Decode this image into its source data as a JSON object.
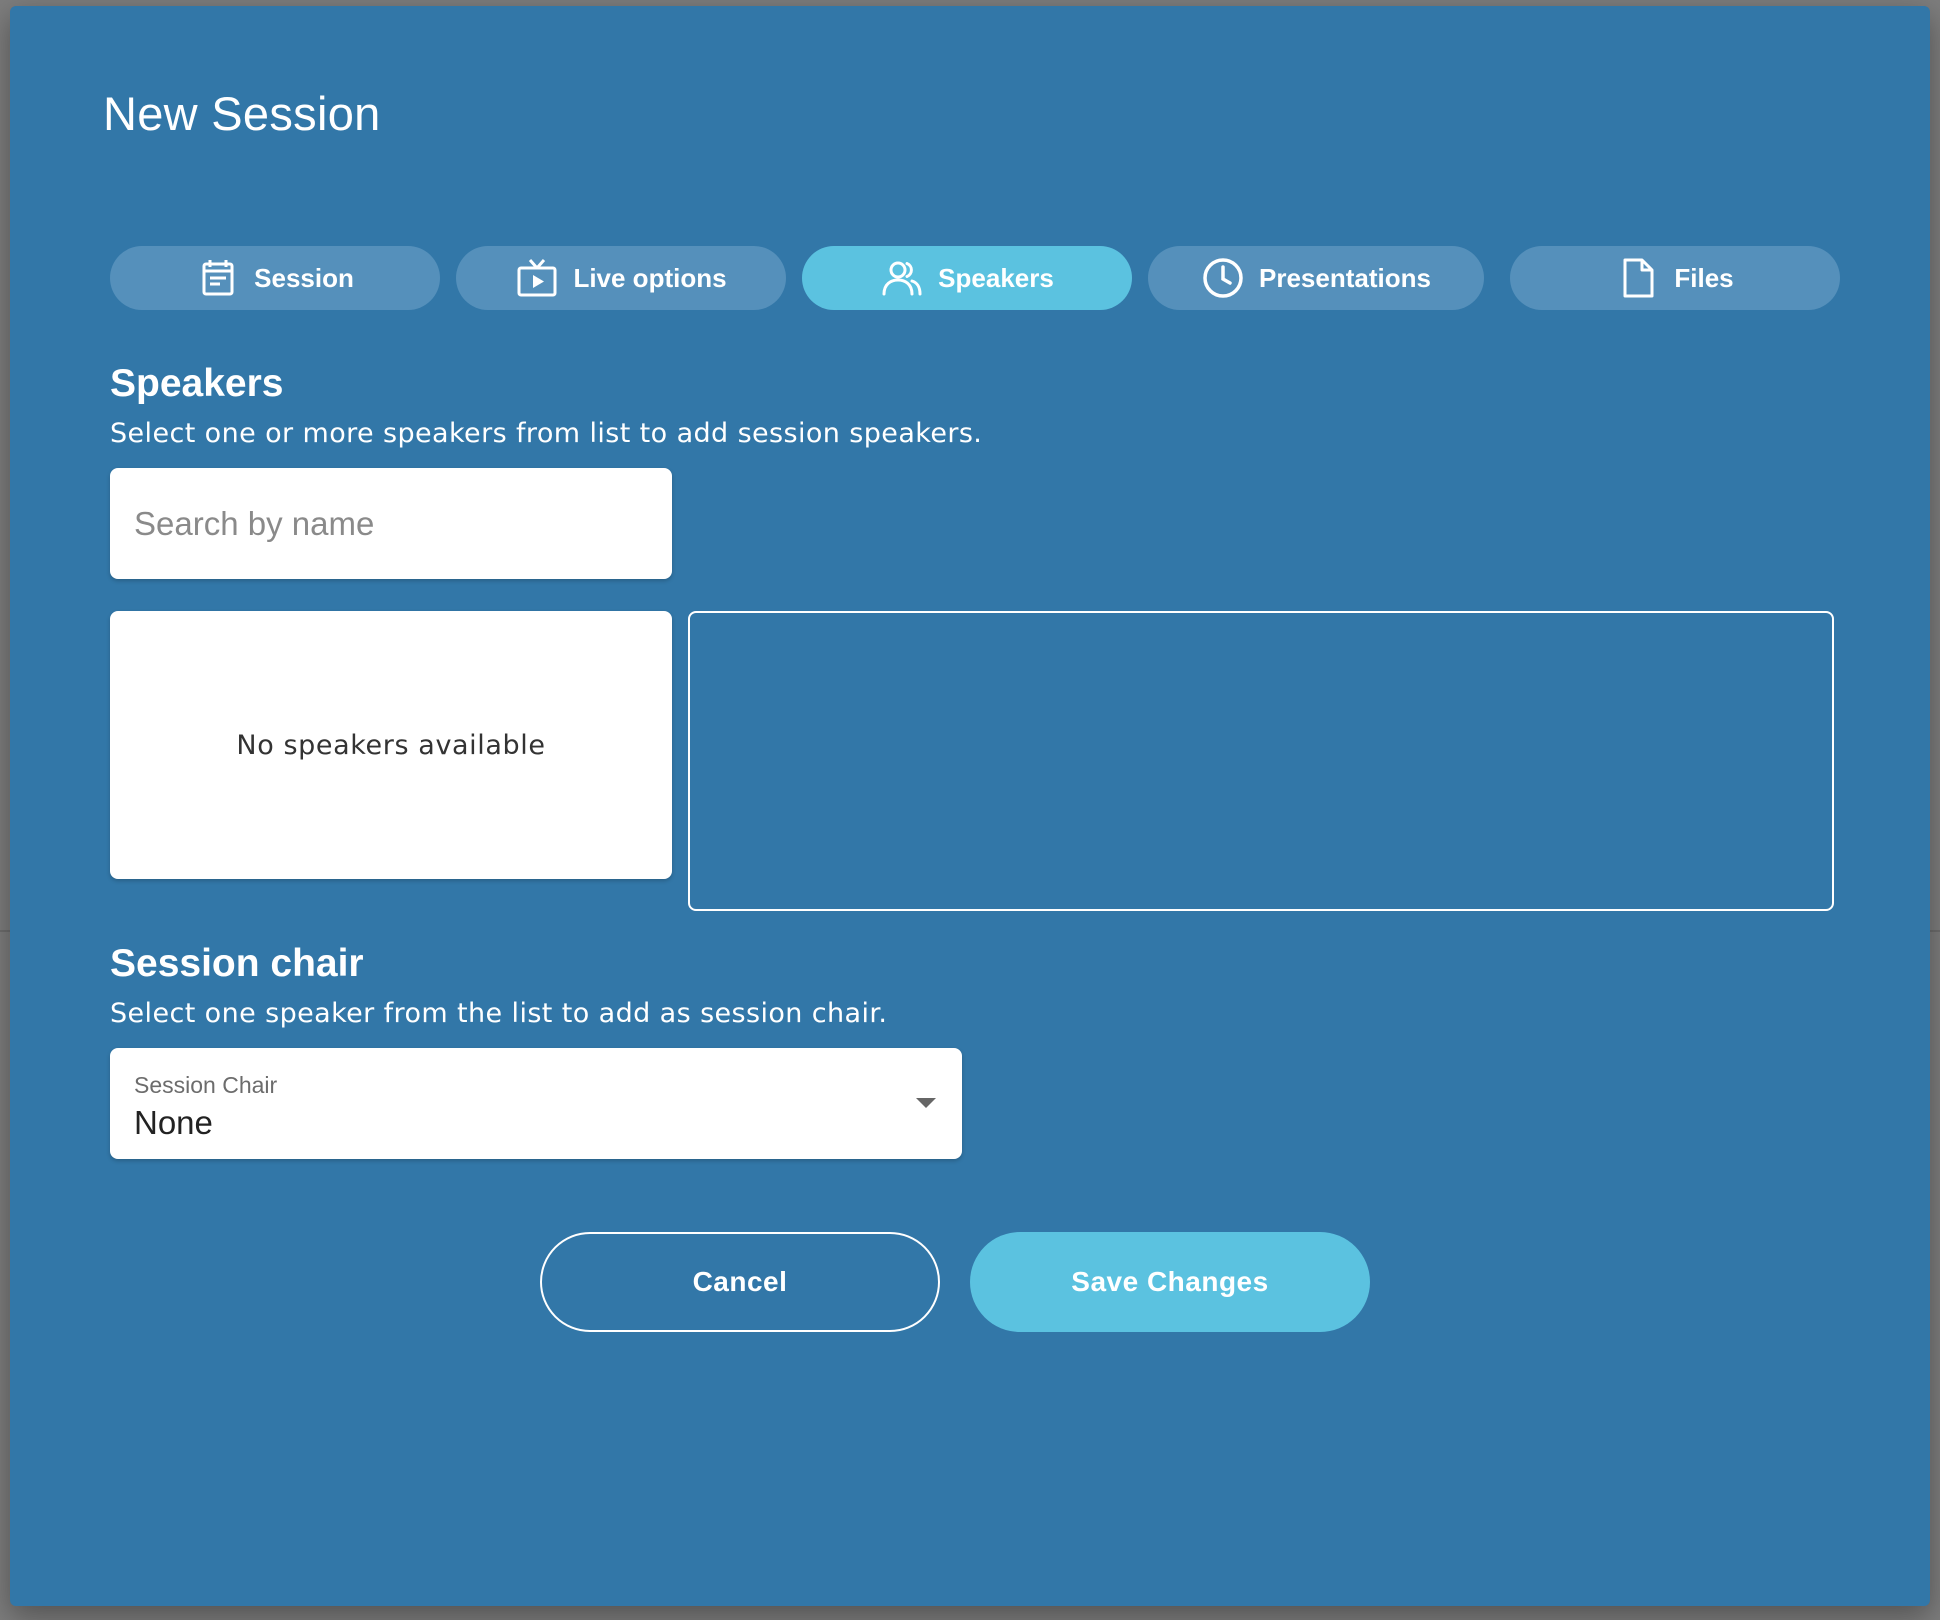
{
  "dialog": {
    "title": "New Session"
  },
  "tabs": [
    {
      "label": "Session",
      "icon": "calendar-icon",
      "active": false
    },
    {
      "label": "Live options",
      "icon": "live-tv-icon",
      "active": false
    },
    {
      "label": "Speakers",
      "icon": "people-icon",
      "active": true
    },
    {
      "label": "Presentations",
      "icon": "clock-icon",
      "active": false
    },
    {
      "label": "Files",
      "icon": "file-icon",
      "active": false
    }
  ],
  "speakers": {
    "heading": "Speakers",
    "description": "Select one or more speakers from list to add session speakers.",
    "search_placeholder": "Search by name",
    "empty_text": "No speakers available"
  },
  "session_chair": {
    "heading": "Session chair",
    "description": "Select one speaker from the list to add as session chair.",
    "field_label": "Session Chair",
    "value": "None"
  },
  "actions": {
    "cancel_label": "Cancel",
    "save_label": "Save Changes"
  },
  "colors": {
    "dialog_bg": "#3277a8",
    "tab_bg": "#5590bb",
    "accent": "#5bc2e0"
  }
}
